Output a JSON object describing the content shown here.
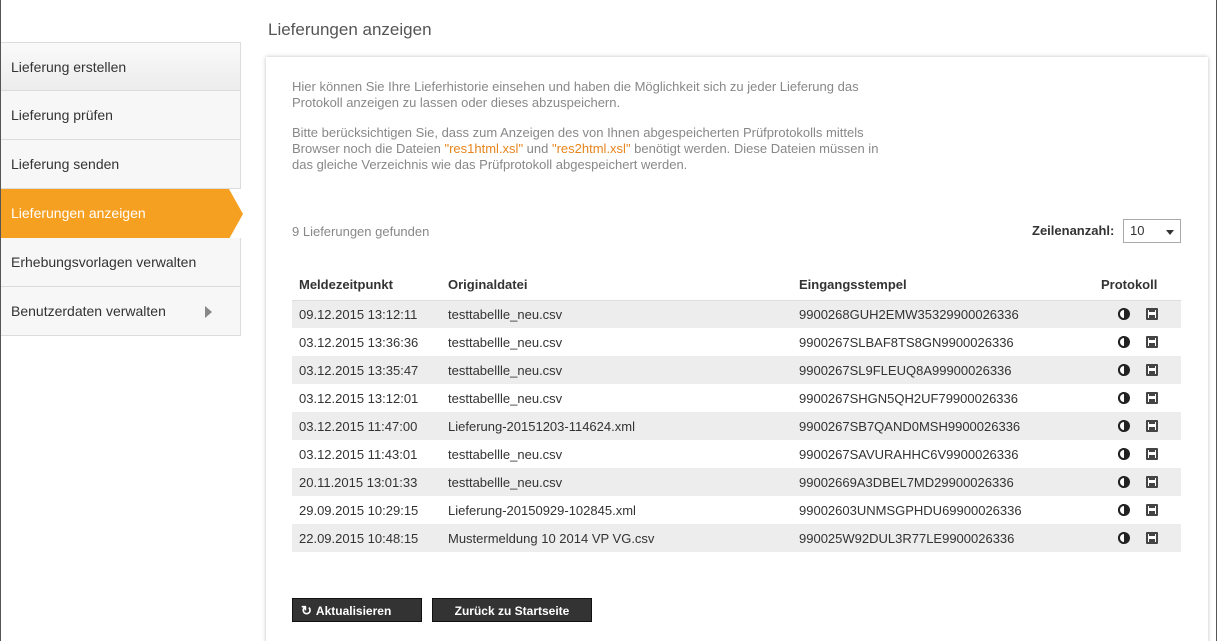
{
  "page": {
    "title": "Lieferungen anzeigen"
  },
  "sidebar": {
    "items": [
      {
        "label": "Lieferung erstellen"
      },
      {
        "label": "Lieferung prüfen"
      },
      {
        "label": "Lieferung senden"
      },
      {
        "label": "Lieferungen anzeigen",
        "active": true
      },
      {
        "label": "Erhebungsvorlagen verwalten"
      },
      {
        "label": "Benutzerdaten verwalten",
        "has_submenu": true
      }
    ],
    "active_color": "#f6a022"
  },
  "intro": {
    "line1": "Hier können Sie Ihre Lieferhistorie einsehen und haben die Möglichkeit sich zu jeder Lieferung das Protokoll anzeigen zu lassen oder dieses abzuspeichern.",
    "line2_a": "Bitte berücksichtigen Sie, dass zum Anzeigen des von Ihnen abgespeicherten Prüfprotokolls mittels Browser noch die Dateien ",
    "link1": "\"res1html.xsl\"",
    "line2_b": " und ",
    "link2": "\"res2html.xsl\"",
    "line2_c": " benötigt werden. Diese Dateien müssen in das gleiche Verzeichnis wie das Prüfprotokoll abgespeichert werden.",
    "link_color": "#e8841c"
  },
  "results": {
    "count_text": "9 Lieferungen gefunden",
    "rows_label": "Zeilenanzahl:",
    "rows_value": "10"
  },
  "table": {
    "headers": {
      "time": "Meldezeitpunkt",
      "file": "Originaldatei",
      "stamp": "Eingangsstempel",
      "protocol": "Protokoll"
    },
    "rows": [
      {
        "time": "09.12.2015 13:12:11",
        "file": "testtabellle_neu.csv",
        "stamp": "9900268GUH2EMW35329900026336"
      },
      {
        "time": "03.12.2015 13:36:36",
        "file": "testtabellle_neu.csv",
        "stamp": "9900267SLBAF8TS8GN9900026336"
      },
      {
        "time": "03.12.2015 13:35:47",
        "file": "testtabellle_neu.csv",
        "stamp": "9900267SL9FLEUQ8A99900026336"
      },
      {
        "time": "03.12.2015 13:12:01",
        "file": "testtabellle_neu.csv",
        "stamp": "9900267SHGN5QH2UF79900026336"
      },
      {
        "time": "03.12.2015 11:47:00",
        "file": "Lieferung-20151203-114624.xml",
        "stamp": "9900267SB7QAND0MSH9900026336"
      },
      {
        "time": "03.12.2015 11:43:01",
        "file": "testtabellle_neu.csv",
        "stamp": "9900267SAVURAHHC6V9900026336"
      },
      {
        "time": "20.11.2015 13:01:33",
        "file": "testtabellle_neu.csv",
        "stamp": "99002669A3DBEL7MD29900026336"
      },
      {
        "time": "29.09.2015 10:29:15",
        "file": "Lieferung-20150929-102845.xml",
        "stamp": "99002603UNMSGPHDU69900026336"
      },
      {
        "time": "22.09.2015 10:48:15",
        "file": "Mustermeldung 10 2014 VP VG.csv",
        "stamp": "990025W92DUL3R77LE9900026336"
      }
    ],
    "row_icons": [
      "view-protocol-icon",
      "save-protocol-icon"
    ]
  },
  "buttons": {
    "refresh_label": "Aktualisieren",
    "refresh_icon": "refresh-icon",
    "back_label": "Zurück zu Startseite"
  }
}
